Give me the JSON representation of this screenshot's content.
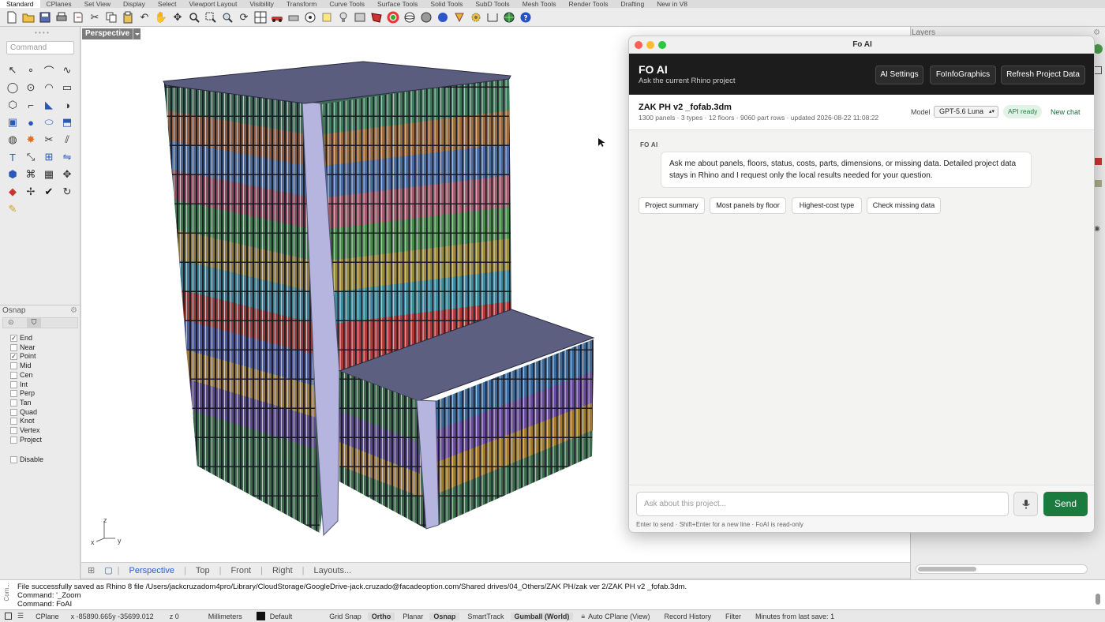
{
  "toolbar_tabs": [
    "Standard",
    "CPlanes",
    "Set View",
    "Display",
    "Select",
    "Viewport Layout",
    "Visibility",
    "Transform",
    "Curve Tools",
    "Surface Tools",
    "Solid Tools",
    "SubD Tools",
    "Mesh Tools",
    "Render Tools",
    "Drafting",
    "New in V8"
  ],
  "command_placeholder": "Command",
  "viewport": {
    "title": "Perspective",
    "tabs": [
      "Perspective",
      "Top",
      "Front",
      "Right",
      "Layouts..."
    ],
    "axis": {
      "x": "x",
      "y": "y",
      "z": "z"
    }
  },
  "osnap": {
    "header": "Osnap",
    "items": [
      {
        "label": "End",
        "checked": true
      },
      {
        "label": "Near",
        "checked": false
      },
      {
        "label": "Point",
        "checked": true
      },
      {
        "label": "Mid",
        "checked": false
      },
      {
        "label": "Cen",
        "checked": false
      },
      {
        "label": "Int",
        "checked": false
      },
      {
        "label": "Perp",
        "checked": false
      },
      {
        "label": "Tan",
        "checked": false
      },
      {
        "label": "Quad",
        "checked": false
      },
      {
        "label": "Knot",
        "checked": false
      },
      {
        "label": "Vertex",
        "checked": false
      },
      {
        "label": "Project",
        "checked": false
      }
    ],
    "disable_label": "Disable"
  },
  "layers_header": "Layers",
  "command_history": [
    "File successfully saved as Rhino 8 file /Users/jackcruzadom4pro/Library/CloudStorage/GoogleDrive-jack.cruzado@facadeoption.com/Shared drives/04_Others/ZAK PH/zak ver 2/ZAK PH v2 _fofab.3dm.",
    "Command: '_Zoom",
    "Command: FoAI"
  ],
  "command_side_label": "Com...",
  "statusbar": {
    "cplane": "CPlane",
    "coords": "x -85890.665y -35699.012",
    "z": "z 0",
    "units": "Millimeters",
    "layer": "Default",
    "gridsnap": "Grid Snap",
    "ortho": "Ortho",
    "planar": "Planar",
    "osnap": "Osnap",
    "smarttrack": "SmartTrack",
    "gumball": "Gumball (World)",
    "autocplane": "Auto CPlane (View)",
    "record": "Record History",
    "filter": "Filter",
    "save": "Minutes from last save: 1"
  },
  "ai": {
    "window_title": "Fo AI",
    "header_title": "FO AI",
    "header_subtitle": "Ask the current Rhino project",
    "buttons": [
      "AI Settings",
      "FoInfoGraphics",
      "Refresh Project Data"
    ],
    "project_name": "ZAK PH v2 _fofab.3dm",
    "project_meta": "1300 panels · 3 types · 12 floors · 9060 part rows · updated 2026-08-22 11:08:22",
    "model_label": "Model",
    "model_value": "GPT-5.6 Luna",
    "api_status": "API ready",
    "new_chat": "New chat",
    "sender": "FO AI",
    "message": "Ask me about panels, floors, status, costs, parts, dimensions, or missing data. Detailed project data stays in Rhino and I request only the local results needed for your question.",
    "chips": [
      "Project summary",
      "Most panels by floor",
      "Highest-cost type",
      "Check missing data"
    ],
    "input_placeholder": "Ask about this project...",
    "send_label": "Send",
    "hint": "Enter to send · Shift+Enter for a new line · FoAI is read-only",
    "accent_color": "#1b7a3e"
  }
}
